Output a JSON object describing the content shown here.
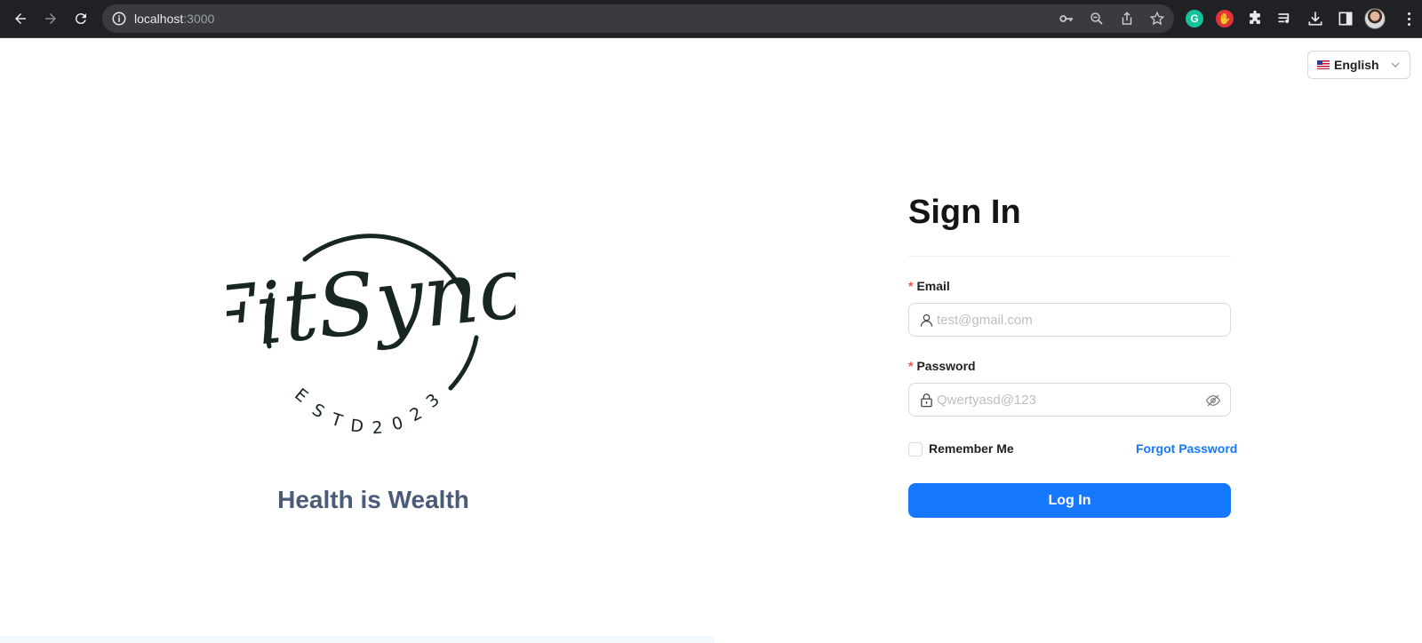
{
  "browser": {
    "url_host": "localhost",
    "url_port": ":3000",
    "icons": [
      "back-icon",
      "forward-icon",
      "reload-icon",
      "info-icon",
      "key-icon",
      "zoom-icon",
      "share-icon",
      "star-icon",
      "grammarly-icon",
      "hand-icon",
      "puzzle-icon",
      "media-icon",
      "download-icon",
      "sidepanel-icon",
      "avatar",
      "menu-icon"
    ]
  },
  "language": {
    "label": "English",
    "flag": "us-flag"
  },
  "brand": {
    "logo_text": "FitSync",
    "logo_sub": "ESTD2023",
    "tagline": "Health is Wealth"
  },
  "form": {
    "title": "Sign In",
    "email_label": "Email",
    "email_placeholder": "test@gmail.com",
    "password_label": "Password",
    "password_placeholder": "Qwertyasd@123",
    "required_mark": "*",
    "remember_label": "Remember Me",
    "forgot_label": "Forgot Password",
    "submit_label": "Log In"
  },
  "colors": {
    "primary": "#1677ff",
    "required": "#ff4d4f",
    "tagline": "#4a5a78"
  }
}
